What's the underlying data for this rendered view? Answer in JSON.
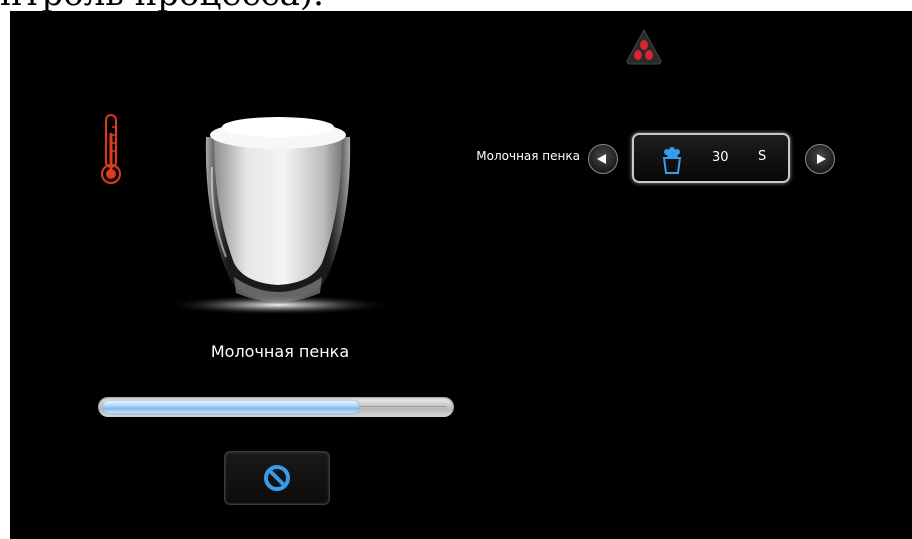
{
  "document": {
    "caption": "нтроль процесса)."
  },
  "product": {
    "name": "Молочная пенка",
    "progress_percent": 74
  },
  "parameter": {
    "label": "Молочная пенка",
    "value": "30",
    "unit": "S"
  },
  "icons": {
    "temperature": "thermometer-icon",
    "beans": "coffee-beans-icon",
    "cancel": "cancel-icon",
    "foam": "milk-foam-icon",
    "prev": "arrow-left-icon",
    "next": "arrow-right-icon"
  },
  "colors": {
    "background": "#000000",
    "thermometer": "#e03a1f",
    "beans": "#d8272c",
    "accent": "#3a9be8"
  }
}
